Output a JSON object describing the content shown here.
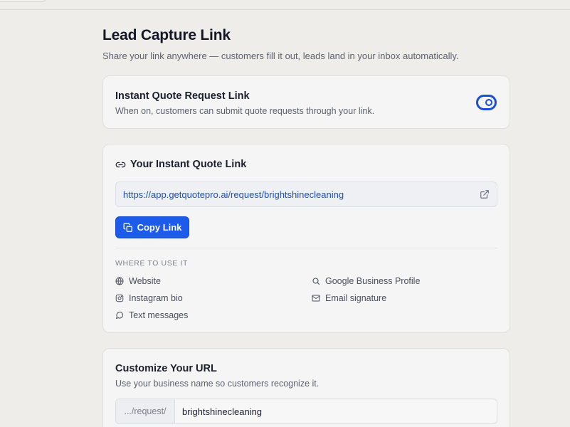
{
  "header": {
    "title": "Lead Capture Link",
    "subtitle": "Share your link anywhere — customers fill it out, leads land in your inbox automatically."
  },
  "toggle_card": {
    "title": "Instant Quote Request Link",
    "description": "When on, customers can submit quote requests through your link.",
    "enabled": true
  },
  "link_card": {
    "title": "Your Instant Quote Link",
    "url": "https://app.getquotepro.ai/request/brightshinecleaning",
    "copy_label": "Copy Link",
    "where_label": "WHERE TO USE IT",
    "uses": [
      {
        "label": "Website",
        "icon": "globe-icon"
      },
      {
        "label": "Google Business Profile",
        "icon": "search-icon"
      },
      {
        "label": "Instagram bio",
        "icon": "instagram-icon"
      },
      {
        "label": "Email signature",
        "icon": "mail-icon"
      },
      {
        "label": "Text messages",
        "icon": "message-icon"
      }
    ]
  },
  "url_card": {
    "title": "Customize Your URL",
    "description": "Use your business name so customers recognize it.",
    "prefix": ".../request/",
    "slug": "brightshinecleaning"
  },
  "colors": {
    "accent": "#1d5bea",
    "background": "#eeede9",
    "card": "#f5f5f5"
  }
}
